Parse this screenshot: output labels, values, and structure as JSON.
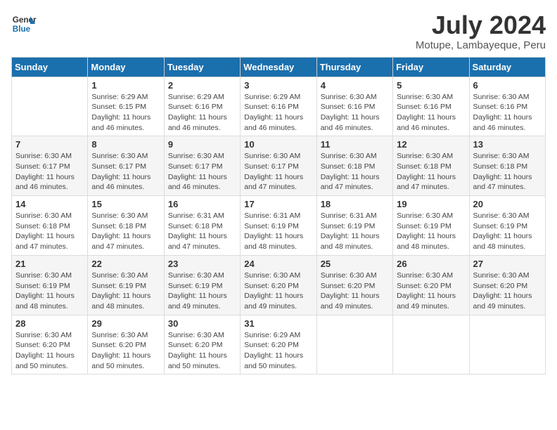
{
  "header": {
    "logo_line1": "General",
    "logo_line2": "Blue",
    "title": "July 2024",
    "subtitle": "Motupe, Lambayeque, Peru"
  },
  "days_of_week": [
    "Sunday",
    "Monday",
    "Tuesday",
    "Wednesday",
    "Thursday",
    "Friday",
    "Saturday"
  ],
  "weeks": [
    [
      {
        "day": "",
        "info": ""
      },
      {
        "day": "1",
        "info": "Sunrise: 6:29 AM\nSunset: 6:15 PM\nDaylight: 11 hours\nand 46 minutes."
      },
      {
        "day": "2",
        "info": "Sunrise: 6:29 AM\nSunset: 6:16 PM\nDaylight: 11 hours\nand 46 minutes."
      },
      {
        "day": "3",
        "info": "Sunrise: 6:29 AM\nSunset: 6:16 PM\nDaylight: 11 hours\nand 46 minutes."
      },
      {
        "day": "4",
        "info": "Sunrise: 6:30 AM\nSunset: 6:16 PM\nDaylight: 11 hours\nand 46 minutes."
      },
      {
        "day": "5",
        "info": "Sunrise: 6:30 AM\nSunset: 6:16 PM\nDaylight: 11 hours\nand 46 minutes."
      },
      {
        "day": "6",
        "info": "Sunrise: 6:30 AM\nSunset: 6:16 PM\nDaylight: 11 hours\nand 46 minutes."
      }
    ],
    [
      {
        "day": "7",
        "info": "Sunrise: 6:30 AM\nSunset: 6:17 PM\nDaylight: 11 hours\nand 46 minutes."
      },
      {
        "day": "8",
        "info": "Sunrise: 6:30 AM\nSunset: 6:17 PM\nDaylight: 11 hours\nand 46 minutes."
      },
      {
        "day": "9",
        "info": "Sunrise: 6:30 AM\nSunset: 6:17 PM\nDaylight: 11 hours\nand 46 minutes."
      },
      {
        "day": "10",
        "info": "Sunrise: 6:30 AM\nSunset: 6:17 PM\nDaylight: 11 hours\nand 47 minutes."
      },
      {
        "day": "11",
        "info": "Sunrise: 6:30 AM\nSunset: 6:18 PM\nDaylight: 11 hours\nand 47 minutes."
      },
      {
        "day": "12",
        "info": "Sunrise: 6:30 AM\nSunset: 6:18 PM\nDaylight: 11 hours\nand 47 minutes."
      },
      {
        "day": "13",
        "info": "Sunrise: 6:30 AM\nSunset: 6:18 PM\nDaylight: 11 hours\nand 47 minutes."
      }
    ],
    [
      {
        "day": "14",
        "info": "Sunrise: 6:30 AM\nSunset: 6:18 PM\nDaylight: 11 hours\nand 47 minutes."
      },
      {
        "day": "15",
        "info": "Sunrise: 6:30 AM\nSunset: 6:18 PM\nDaylight: 11 hours\nand 47 minutes."
      },
      {
        "day": "16",
        "info": "Sunrise: 6:31 AM\nSunset: 6:18 PM\nDaylight: 11 hours\nand 47 minutes."
      },
      {
        "day": "17",
        "info": "Sunrise: 6:31 AM\nSunset: 6:19 PM\nDaylight: 11 hours\nand 48 minutes."
      },
      {
        "day": "18",
        "info": "Sunrise: 6:31 AM\nSunset: 6:19 PM\nDaylight: 11 hours\nand 48 minutes."
      },
      {
        "day": "19",
        "info": "Sunrise: 6:30 AM\nSunset: 6:19 PM\nDaylight: 11 hours\nand 48 minutes."
      },
      {
        "day": "20",
        "info": "Sunrise: 6:30 AM\nSunset: 6:19 PM\nDaylight: 11 hours\nand 48 minutes."
      }
    ],
    [
      {
        "day": "21",
        "info": "Sunrise: 6:30 AM\nSunset: 6:19 PM\nDaylight: 11 hours\nand 48 minutes."
      },
      {
        "day": "22",
        "info": "Sunrise: 6:30 AM\nSunset: 6:19 PM\nDaylight: 11 hours\nand 48 minutes."
      },
      {
        "day": "23",
        "info": "Sunrise: 6:30 AM\nSunset: 6:19 PM\nDaylight: 11 hours\nand 49 minutes."
      },
      {
        "day": "24",
        "info": "Sunrise: 6:30 AM\nSunset: 6:20 PM\nDaylight: 11 hours\nand 49 minutes."
      },
      {
        "day": "25",
        "info": "Sunrise: 6:30 AM\nSunset: 6:20 PM\nDaylight: 11 hours\nand 49 minutes."
      },
      {
        "day": "26",
        "info": "Sunrise: 6:30 AM\nSunset: 6:20 PM\nDaylight: 11 hours\nand 49 minutes."
      },
      {
        "day": "27",
        "info": "Sunrise: 6:30 AM\nSunset: 6:20 PM\nDaylight: 11 hours\nand 49 minutes."
      }
    ],
    [
      {
        "day": "28",
        "info": "Sunrise: 6:30 AM\nSunset: 6:20 PM\nDaylight: 11 hours\nand 50 minutes."
      },
      {
        "day": "29",
        "info": "Sunrise: 6:30 AM\nSunset: 6:20 PM\nDaylight: 11 hours\nand 50 minutes."
      },
      {
        "day": "30",
        "info": "Sunrise: 6:30 AM\nSunset: 6:20 PM\nDaylight: 11 hours\nand 50 minutes."
      },
      {
        "day": "31",
        "info": "Sunrise: 6:29 AM\nSunset: 6:20 PM\nDaylight: 11 hours\nand 50 minutes."
      },
      {
        "day": "",
        "info": ""
      },
      {
        "day": "",
        "info": ""
      },
      {
        "day": "",
        "info": ""
      }
    ]
  ]
}
